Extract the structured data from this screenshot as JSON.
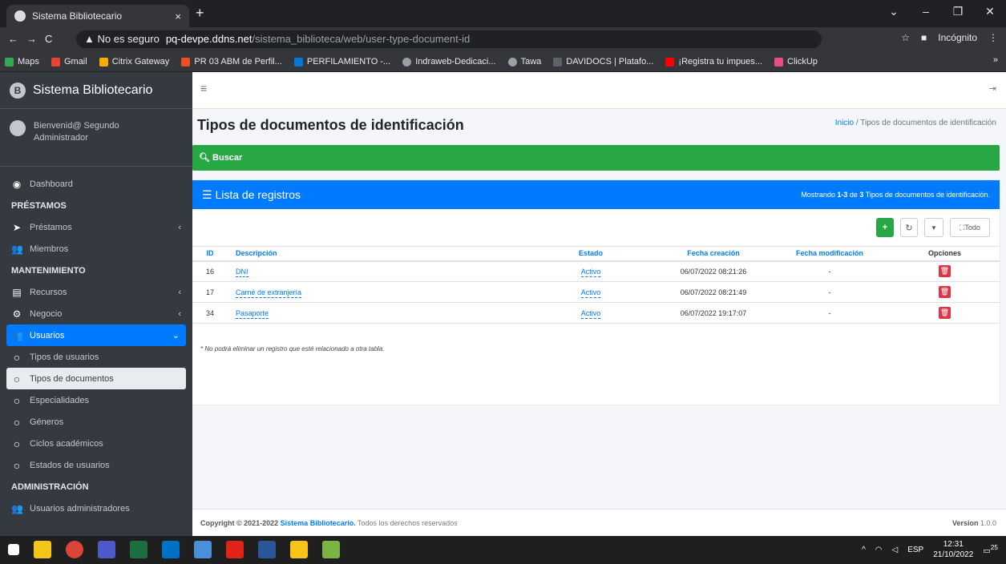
{
  "browser": {
    "tab_title": "Sistema Bibliotecario",
    "tab_close": "×",
    "new_tab": "+",
    "url_warning": "▲ No es seguro",
    "url_host": "pq-devpe.ddns.net",
    "url_path": "/sistema_biblioteca/web/user-type-document-id",
    "incognito": "Incógnito",
    "bookmarks": [
      "Maps",
      "Gmail",
      "Citrix Gateway",
      "PR 03 ABM de Perfil...",
      "PERFILAMIENTO -...",
      "Indraweb-Dedicaci...",
      "Tawa",
      "DAVIDOCS | Platafo...",
      "¡Registra tu impues...",
      "ClickUp"
    ]
  },
  "sidebar": {
    "brand": "Sistema Bibliotecario",
    "user_greeting": "Bienvenid@ Segundo",
    "user_role": "Administrador",
    "dashboard": "Dashboard",
    "h_prestamos": "PRÉSTAMOS",
    "prestamos": "Préstamos",
    "miembros": "Miembros",
    "h_mantenimiento": "MANTENIMIENTO",
    "recursos": "Recursos",
    "negocio": "Negocio",
    "usuarios": "Usuarios",
    "tipos_usuarios": "Tipos de usuarios",
    "tipos_documentos": "Tipos de documentos",
    "especialidades": "Especialidades",
    "generos": "Géneros",
    "ciclos": "Ciclos académicos",
    "estados": "Estados de usuarios",
    "h_administracion": "ADMINISTRACIÓN",
    "usuarios_admin": "Usuarios administradores"
  },
  "page": {
    "title": "Tipos de documentos de identificación",
    "breadcrumb_home": "Inicio",
    "breadcrumb_sep": "/",
    "breadcrumb_current": "Tipos de documentos de identificación",
    "search_label": "Buscar",
    "list_title": "Lista de registros",
    "summary_prefix": "Mostrando ",
    "summary_range": "1-3",
    "summary_mid": " de ",
    "summary_total": "3",
    "summary_suffix": " Tipos de documentos de identificación.",
    "btn_all": "Todo",
    "note": "* No podrá eliminar un registro que esté relacionado a otra tabla."
  },
  "table": {
    "headers": [
      "ID",
      "Descripción",
      "Estado",
      "Fecha creación",
      "Fecha modificación",
      "Opciones"
    ],
    "rows": [
      {
        "id": "16",
        "desc": "DNI",
        "estado": "Activo",
        "creado": "06/07/2022 08:21:26",
        "modificado": "-"
      },
      {
        "id": "17",
        "desc": "Carné de extranjería",
        "estado": "Activo",
        "creado": "06/07/2022 08:21:49",
        "modificado": "-"
      },
      {
        "id": "34",
        "desc": "Pasaporte",
        "estado": "Activo",
        "creado": "06/07/2022 19:17:07",
        "modificado": "-"
      }
    ]
  },
  "footer": {
    "copyright_prefix": "Copyright © 2021-2022 ",
    "brand": "Sistema Bibliotecario.",
    "rights": " Todos los derechos reservados",
    "version_label": "Version",
    "version": "1.0.0"
  },
  "taskbar": {
    "lang": "ESP",
    "time": "12:31",
    "date": "21/10/2022",
    "notif": "25"
  },
  "colors": {
    "primary": "#007bff",
    "success": "#28a745",
    "danger": "#dc3545",
    "sidebar": "#343a40"
  }
}
